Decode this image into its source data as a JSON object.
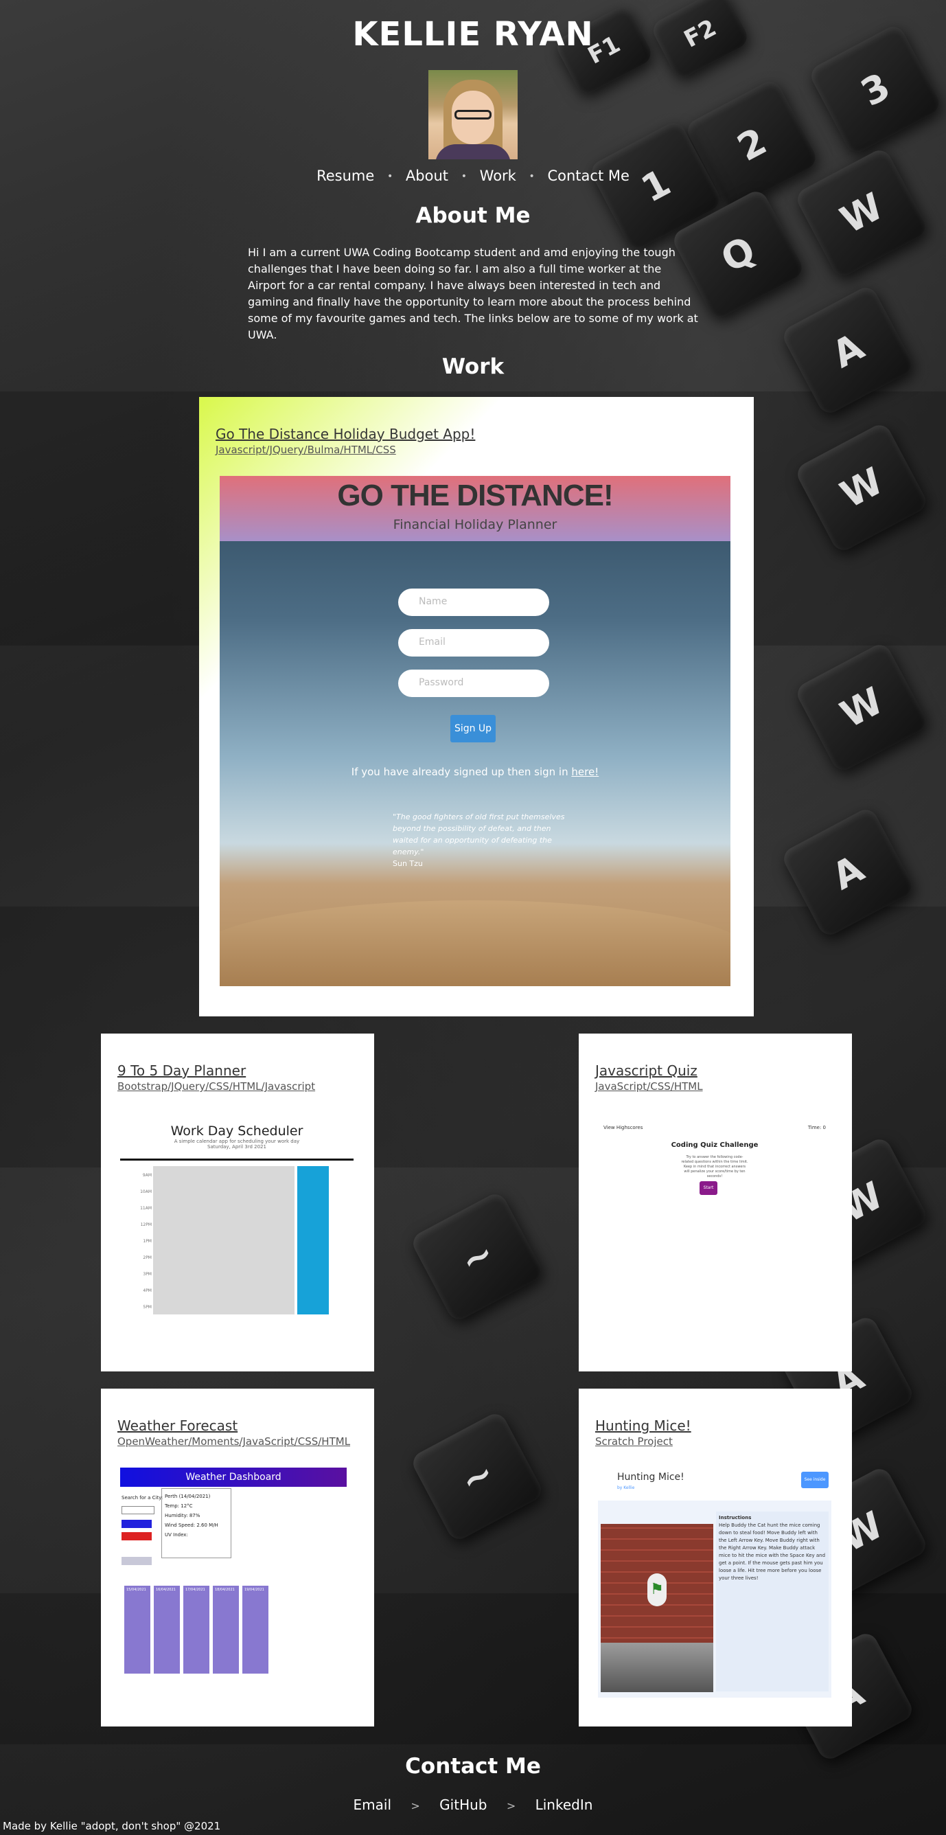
{
  "header": {
    "name": "KELLIE RYAN",
    "nav": [
      "Resume",
      "About",
      "Work",
      "Contact Me"
    ]
  },
  "about": {
    "title": "About Me",
    "text": "Hi I am a current UWA Coding Bootcamp student and amd enjoying the tough challenges that I have been doing so far. I am also a full time worker at the Airport for a car rental company. I have always been interested in tech and gaming and finally have the opportunity to learn more about the process behind some of my favourite games and tech. The links below are to some of my work at UWA."
  },
  "work": {
    "title": "Work",
    "featured": {
      "title": "Go The Distance Holiday Budget App!",
      "subtitle": "Javascript/JQuery/Bulma/HTML/CSS",
      "shot": {
        "heading": "GO THE DISTANCE!",
        "subheading": "Financial Holiday Planner",
        "name_ph": "Name",
        "email_ph": "Email",
        "password_ph": "Password",
        "signup": "Sign Up",
        "signin_text": "If you have already signed up then sign in",
        "signin_link": "here!",
        "quote": "\"The good fighters of old first put themselves beyond the possibility of defeat, and then waited for an opportunity of defeating the enemy.\"",
        "quote_author": "Sun Tzu"
      }
    },
    "projects": [
      {
        "title": "9 To 5 Day Planner",
        "subtitle": "Bootstrap/JQuery/CSS/HTML/Javascript",
        "shot_title": "Work Day Scheduler",
        "shot_sub": "A simple calendar app for scheduling your work day",
        "shot_date": "Saturday, April 3rd 2021",
        "hours": [
          "9AM",
          "10AM",
          "11AM",
          "12PM",
          "1PM",
          "2PM",
          "3PM",
          "4PM",
          "5PM"
        ]
      },
      {
        "title": "Javascript Quiz",
        "subtitle": "JavaScript/CSS/HTML",
        "shot_left": "View Highscores",
        "shot_right": "Time: 0",
        "shot_title": "Coding Quiz Challenge",
        "shot_desc": "Try to answer the following code-related questions within the time limit. Keep in mind that incorrect answers will penalize your score/time by ten seconds!",
        "shot_button": "Start Quiz!"
      },
      {
        "title": "Weather Forecast",
        "subtitle": "OpenWeather/Moments/JavaScript/CSS/HTML",
        "shot_title": "Weather Dashboard",
        "shot_label": "Search for a City:",
        "today_city": "Perth (14/04/2021)",
        "today_lines": [
          "Temp: 12°C",
          "Humidity: 87%",
          "Wind Speed: 2.60 M/H",
          "UV Index:"
        ],
        "forecast_dates": [
          "15/04/2021",
          "16/04/2021",
          "17/04/2021",
          "18/04/2021",
          "19/04/2021"
        ]
      },
      {
        "title": "Hunting Mice!",
        "subtitle": "Scratch Project",
        "shot_title": "Hunting Mice!",
        "shot_author": "by Kellie",
        "shot_button": "See inside",
        "instructions_title": "Instructions",
        "instructions": "Help Buddy the Cat hunt the mice coming down to steal food! Move Buddy left with the Left Arrow Key. Move Buddy right with the Right Arrow Key. Make Buddy attack mice to hit the mice with the Space Key and get a point. If the mouse gets past him you loose a life. Hit tree more before you loose your three lives!"
      }
    ]
  },
  "contact": {
    "title": "Contact Me",
    "links": [
      "Email",
      "GitHub",
      "LinkedIn"
    ]
  },
  "footer": "Made by Kellie \"adopt, don't shop\" @2021"
}
